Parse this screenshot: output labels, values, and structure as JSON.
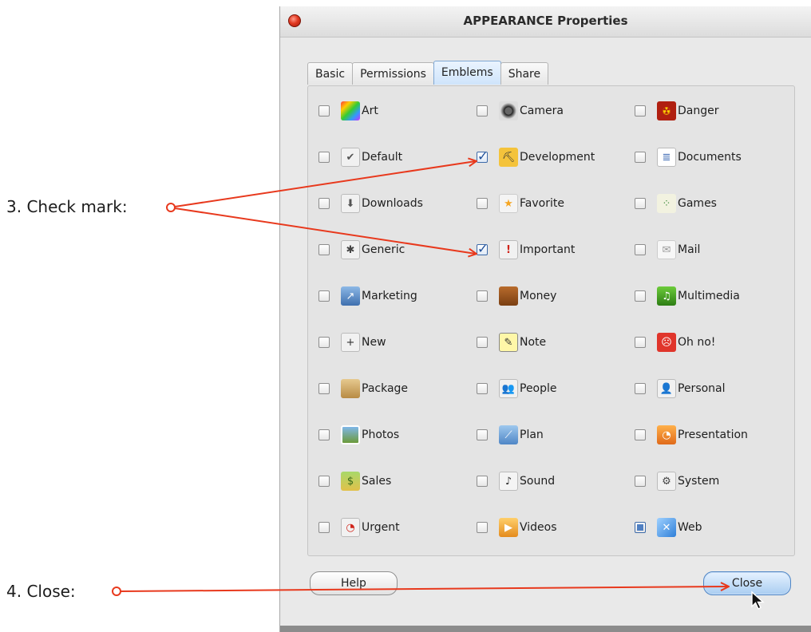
{
  "window": {
    "title": "APPEARANCE Properties"
  },
  "tabs": [
    {
      "label": "Basic",
      "active": false
    },
    {
      "label": "Permissions",
      "active": false
    },
    {
      "label": "Emblems",
      "active": true
    },
    {
      "label": "Share",
      "active": false
    }
  ],
  "emblems": [
    {
      "label": "Art",
      "icon": "art-icon",
      "state": "unchecked"
    },
    {
      "label": "Camera",
      "icon": "camera-icon",
      "state": "unchecked"
    },
    {
      "label": "Danger",
      "icon": "danger-icon",
      "state": "unchecked"
    },
    {
      "label": "Default",
      "icon": "default-icon",
      "state": "unchecked"
    },
    {
      "label": "Development",
      "icon": "development-icon",
      "state": "checked"
    },
    {
      "label": "Documents",
      "icon": "documents-icon",
      "state": "unchecked"
    },
    {
      "label": "Downloads",
      "icon": "downloads-icon",
      "state": "unchecked"
    },
    {
      "label": "Favorite",
      "icon": "favorite-icon",
      "state": "unchecked"
    },
    {
      "label": "Games",
      "icon": "games-icon",
      "state": "unchecked"
    },
    {
      "label": "Generic",
      "icon": "generic-icon",
      "state": "unchecked"
    },
    {
      "label": "Important",
      "icon": "important-icon",
      "state": "checked"
    },
    {
      "label": "Mail",
      "icon": "mail-icon",
      "state": "unchecked"
    },
    {
      "label": "Marketing",
      "icon": "marketing-icon",
      "state": "unchecked"
    },
    {
      "label": "Money",
      "icon": "money-icon",
      "state": "unchecked"
    },
    {
      "label": "Multimedia",
      "icon": "multimedia-icon",
      "state": "unchecked"
    },
    {
      "label": "New",
      "icon": "new-icon",
      "state": "unchecked"
    },
    {
      "label": "Note",
      "icon": "note-icon",
      "state": "unchecked"
    },
    {
      "label": "Oh no!",
      "icon": "oh-no-icon",
      "state": "unchecked"
    },
    {
      "label": "Package",
      "icon": "package-icon",
      "state": "unchecked"
    },
    {
      "label": "People",
      "icon": "people-icon",
      "state": "unchecked"
    },
    {
      "label": "Personal",
      "icon": "personal-icon",
      "state": "unchecked"
    },
    {
      "label": "Photos",
      "icon": "photos-icon",
      "state": "unchecked"
    },
    {
      "label": "Plan",
      "icon": "plan-icon",
      "state": "unchecked"
    },
    {
      "label": "Presentation",
      "icon": "presentation-icon",
      "state": "unchecked"
    },
    {
      "label": "Sales",
      "icon": "sales-icon",
      "state": "unchecked"
    },
    {
      "label": "Sound",
      "icon": "sound-icon",
      "state": "unchecked"
    },
    {
      "label": "System",
      "icon": "system-icon",
      "state": "unchecked"
    },
    {
      "label": "Urgent",
      "icon": "urgent-icon",
      "state": "unchecked"
    },
    {
      "label": "Videos",
      "icon": "videos-icon",
      "state": "unchecked"
    },
    {
      "label": "Web",
      "icon": "web-icon",
      "state": "partial"
    }
  ],
  "buttons": {
    "help": "Help",
    "close": "Close"
  },
  "annotations": {
    "check_mark": "3. Check mark:",
    "close": "4. Close:",
    "color": "#e8391d"
  }
}
